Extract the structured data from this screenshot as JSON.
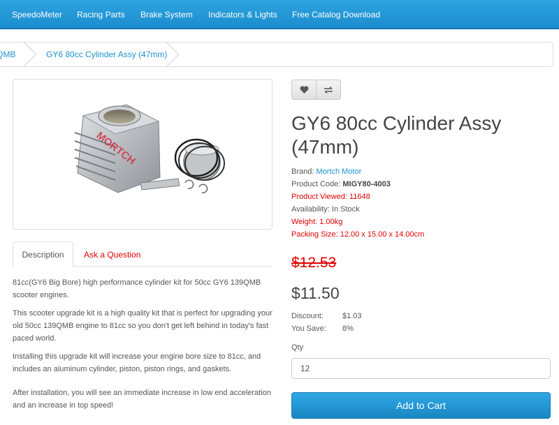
{
  "topnav": {
    "items": [
      "SpeedoMeter",
      "Racing Parts",
      "Brake System",
      "Indicators & Lights",
      "Free Catalog Download"
    ]
  },
  "breadcrumb": {
    "items": [
      "QMB",
      "GY6 80cc Cylinder Assy (47mm)"
    ]
  },
  "product_image": {
    "watermark": "MORTCH"
  },
  "tabs": {
    "description": "Description",
    "ask": "Ask a Question"
  },
  "description": {
    "paragraphs": [
      "81cc(GY6 Big Bore) high performance cylinder kit for 50cc GY6 139QMB scooter engines.",
      "This scooter upgrade kit is a high quality kit that is perfect for upgrading your old 50cc 139QMB engine to 81cc so you don't get left behind in today's fast paced world.",
      "Installing this upgrade kit will increase your engine bore size to 81cc, and includes an aluminum cylinder, piston, piston rings, and gaskets.",
      "After installation, you will see an immediate increase in low end acceleration and an increase in top speed!"
    ]
  },
  "actions": {
    "wishlist_icon": "heart-icon",
    "compare_icon": "compare-arrows-icon"
  },
  "product": {
    "title": "GY6 80cc Cylinder Assy (47mm)",
    "brand_label": "Brand:",
    "brand": "Mortch Motor",
    "code_label": "Product Code:",
    "code": "MIGY80-4003",
    "viewed_label": "Product Viewed:",
    "viewed": "11648",
    "availability_label": "Availability:",
    "availability": "In Stock",
    "weight_label": "Weight:",
    "weight": "1.00kg",
    "packing_label": "Packing Size:",
    "packing": "12.00 x 15.00 x 14.00cm"
  },
  "pricing": {
    "old_price": "$12.53",
    "new_price": "$11.50",
    "discount_label": "Discount:",
    "discount": "$1.03",
    "save_label": "You Save:",
    "save": "8%"
  },
  "cart": {
    "qty_label": "Qty",
    "qty_value": "12",
    "add_label": "Add to Cart"
  },
  "colors": {
    "accent": "#1e91cf",
    "nav": "#2fa4e0",
    "alert": "#e00000"
  }
}
